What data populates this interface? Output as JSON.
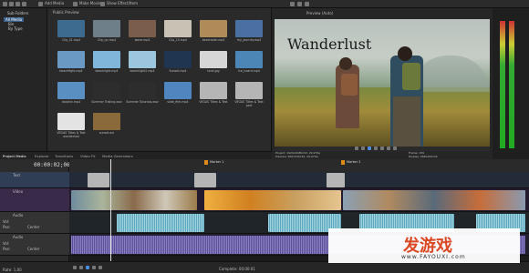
{
  "topbar": {
    "menu_items": [
      "Add Media",
      "Make Movie",
      "Show Effect/Item"
    ]
  },
  "explorer": {
    "header": "Sub Folders",
    "items": [
      "All Media",
      "Bin",
      "By Type"
    ]
  },
  "media": {
    "header": "Public Preview",
    "items": [
      {
        "label": "Clip_01.mp4",
        "color": "#3d6a8f"
      },
      {
        "label": "Clip_lyc.mp4",
        "color": "#6e7f8a"
      },
      {
        "label": "wave.mp4",
        "color": "#7a5d4a"
      },
      {
        "label": "Clip_10.mp4",
        "color": "#c9c2b4"
      },
      {
        "label": "beachside.mp4",
        "color": "#b08b5a"
      },
      {
        "label": "my_journey.mp4",
        "color": "#4a6fa1"
      },
      {
        "label": "beachfight.mp4",
        "color": "#6a9ac4"
      },
      {
        "label": "beachlight.mp4",
        "color": "#7fb6d9"
      },
      {
        "label": "beachlight2.mp4",
        "color": "#9bc6de"
      },
      {
        "label": "Sunset.mp4",
        "color": "#1f3550"
      },
      {
        "label": "tone.jpg",
        "color": "#d6d6d6"
      },
      {
        "label": "Ice_hoard.mp4",
        "color": "#4c86b7"
      },
      {
        "label": "dolphin.mp4",
        "color": "#5a8fc2"
      },
      {
        "label": "Summer Trailing.wav",
        "color": "#2d2d2d"
      },
      {
        "label": "Summer Tutorials.wav",
        "color": "#2d2d2d"
      },
      {
        "label": "slide_film.mp4",
        "color": "#4f86c0"
      },
      {
        "label": "VEGAS Titles & Text",
        "color": "#b5b5b5"
      },
      {
        "label": "VEGAS Titles & Text part",
        "color": "#b5b5b5"
      },
      {
        "label": "VEGAS Titles & Text wanderlust",
        "color": "#e3e3e3"
      },
      {
        "label": "sunset.avi",
        "color": "#8a6a3a"
      }
    ]
  },
  "tabs": [
    "Project Media",
    "Explorer",
    "Transitions",
    "Video FX",
    "Media Generators"
  ],
  "preview": {
    "header": "Preview (Auto)",
    "title_text": "Wanderlust",
    "info_left": [
      "Project: 1920x1080x32, 29.970p",
      "Preview: 960x540x32, 29.970p"
    ],
    "info_right": [
      "Frame: 159",
      "Display: 466x262x32"
    ]
  },
  "timeline": {
    "timecode": "00:00:02;06",
    "markers": [
      "Marker 1",
      "Marker 2"
    ],
    "tracks": [
      {
        "name": "Text",
        "type": "video"
      },
      {
        "name": "Video",
        "type": "video"
      },
      {
        "name": "Audio",
        "type": "audio",
        "vol": "Vol:",
        "pan": "Pan:",
        "center": "Center"
      },
      {
        "name": "Audio",
        "type": "audio",
        "vol": "Vol:",
        "pan": "Pan:",
        "center": "Center"
      }
    ]
  },
  "bottombar": {
    "status": "Rate: 1,00",
    "record_time": "Complete: 00:00:01"
  },
  "watermark": {
    "main": "发游戏",
    "sub": "www.FAYOUXI.com"
  }
}
